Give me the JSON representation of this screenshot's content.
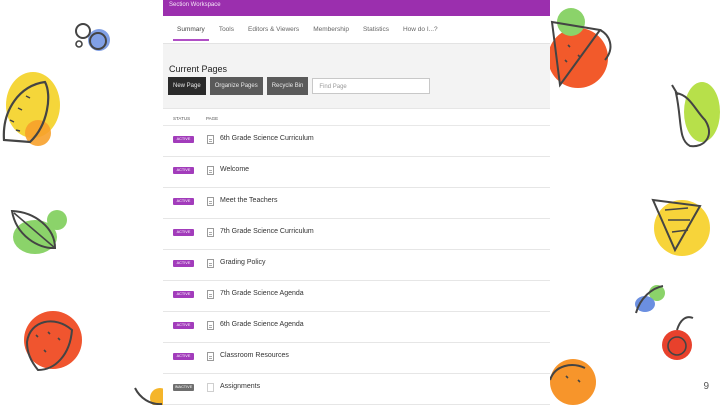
{
  "app": {
    "title": "Section Workspace"
  },
  "tabs": [
    {
      "label": "Summary"
    },
    {
      "label": "Tools"
    },
    {
      "label": "Editors & Viewers"
    },
    {
      "label": "Membership"
    },
    {
      "label": "Statistics"
    },
    {
      "label": "How do I...?"
    }
  ],
  "current_pages": {
    "title": "Current Pages",
    "buttons": {
      "new_page": "New Page",
      "organize_pages": "Organize Pages",
      "recycle_bin": "Recycle Bin"
    },
    "search": {
      "placeholder": "Find Page"
    }
  },
  "table": {
    "columns": {
      "status": "STATUS",
      "page": "PAGE"
    },
    "rows": [
      {
        "status": "ACTIVE",
        "name": "6th Grade Science Curriculum"
      },
      {
        "status": "ACTIVE",
        "name": "Welcome"
      },
      {
        "status": "ACTIVE",
        "name": "Meet the Teachers"
      },
      {
        "status": "ACTIVE",
        "name": "7th Grade Science Curriculum"
      },
      {
        "status": "ACTIVE",
        "name": "Grading Policy"
      },
      {
        "status": "ACTIVE",
        "name": "7th Grade Science Agenda"
      },
      {
        "status": "ACTIVE",
        "name": "6th Grade Science Agenda"
      },
      {
        "status": "ACTIVE",
        "name": "Classroom Resources"
      },
      {
        "status": "INACTIVE",
        "name": "Assignments"
      }
    ]
  },
  "slide_number": "9",
  "colors": {
    "accent": "#9b2fae",
    "badge_active": "#a23cbb",
    "badge_inactive": "#6e6e6e"
  }
}
